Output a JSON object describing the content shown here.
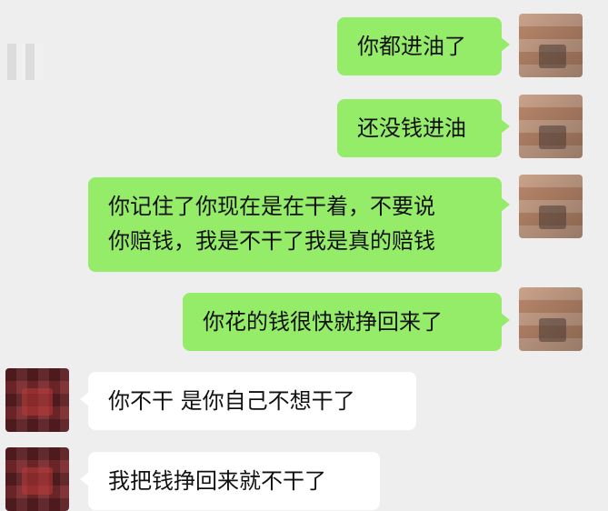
{
  "messages": [
    {
      "side": "right",
      "text": "你都进油了"
    },
    {
      "side": "right",
      "text": "还没钱进油"
    },
    {
      "side": "right",
      "lines": [
        "你记住了你现在是在干着，不要说",
        "你赔钱，我是不干了我是真的赔钱"
      ]
    },
    {
      "side": "right",
      "text": "你花的钱很快就挣回来了"
    },
    {
      "side": "left",
      "text": "你不干 是你自己不想干了"
    },
    {
      "side": "left",
      "text": "我把钱挣回来就不干了"
    }
  ],
  "colors": {
    "sent_bubble": "#95ec69",
    "received_bubble": "#ffffff",
    "background": "#eeeeee"
  }
}
